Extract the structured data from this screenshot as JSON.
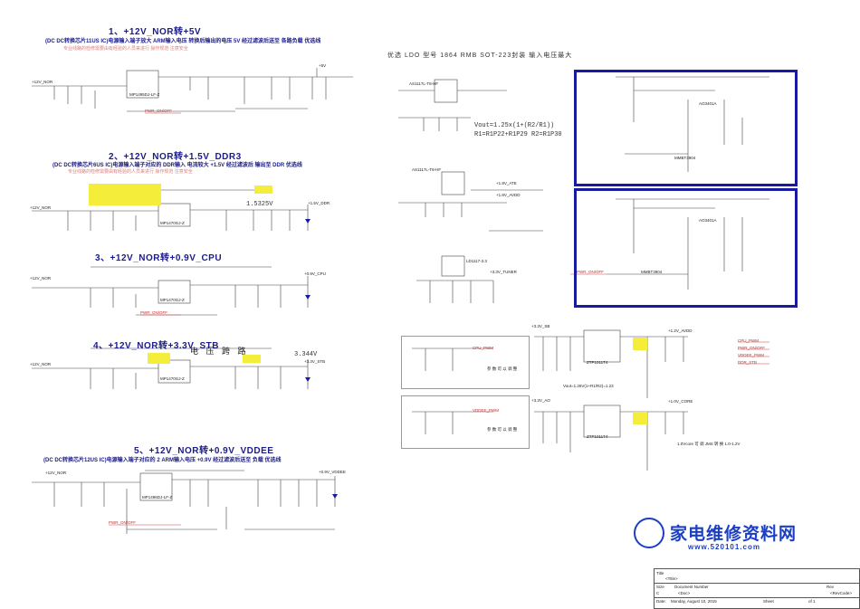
{
  "sections": {
    "s1": {
      "title": "1、+12V_NOR转+5V",
      "note": "(DC DC转换芯片11US IC)电源输入端子放大 ARM输入电压 转换后输出的电压 5V 经过滤波后送至 各路负载 优选线",
      "warn": "专业线路的检修需要由有经验的人员来进行 操作规范 注意安全"
    },
    "s2": {
      "title": "2、+12V_NOR转+1.5V_DDR3",
      "note": "(DC DC转换芯片6US IC)电源输入端子对应的 DDR输入 电流较大 +1.5V 经过滤波后 输出至 DDR 优选线",
      "warn": "专业线路的检修需要由有经验的人员来进行 操作规范 注意安全"
    },
    "s3": {
      "title": "3、+12V_NOR转+0.9V_CPU"
    },
    "s4": {
      "title": "4、+12V_NOR转+3.3V_STB",
      "extra": "电  压  跨  路"
    },
    "s5": {
      "title": "5、+12V_NOR转+0.9V_VDDEE",
      "note": "(DC DC转换芯片12US IC)电源输入端子对应的 2 ARM输入电压 +0.9V 经过滤波后送至 负载 优选线"
    }
  },
  "ldo": {
    "note": "优选 LDO 型号 1864 RMB  SOT-223封装  输入电压最大",
    "formula1": "Vout=1.25x(1+(R2/R1))",
    "formula2": "R1=R1P22+R1P29  R2=R1P30"
  },
  "voltages": {
    "ddr": "1.5325V",
    "stb": "3.344V"
  },
  "chips": [
    "MP1495DJ-LF-Z",
    "MP1470GJ-Z",
    "MP1470GJ-Z",
    "MP1470GJ-Z",
    "MP1496DJ-LF-Z",
    "AS1117L-T8-HF",
    "AS1117L-T8-HF",
    "LD1117-3.3",
    "ZTP1011T4",
    "ZTP1011T4",
    "AO3401A",
    "AO3401A",
    "MMBT3904",
    "MMBT3904"
  ],
  "nets": [
    "+12V_NOR",
    "+5V",
    "+1.5V_DDR",
    "+0.9V_CPU",
    "+3.3V_STB",
    "+0.9V_VDDEE",
    "+3.3V_SB",
    "+3.3V_AO",
    "+1.2V_AVDD",
    "+1.0V_CORE",
    "+1.8V_ATE",
    "+1.8V_AVDD",
    "+3.3V_TUNER",
    "PWR_ON/OFF",
    "CPU_PWM",
    "VDDEE_PWM",
    "DDR_STB",
    "STB_PWM"
  ],
  "dividers": [
    "参 数 可 以 调 整",
    "参 数 可 以 调 整"
  ],
  "notes": {
    "core": "1.0Vcore 可 调 JMS 转 换 1.0-1.2V",
    "avdd": "Vout=1.26V(1+R1/R2)=1.23"
  },
  "title_block": {
    "title": "Title",
    "title_val": "<Title>",
    "size": "Size",
    "size_val": "C",
    "docnum": "Document Number",
    "doc_val": "<Doc>",
    "rev": "Rev",
    "rev_val": "<RevCode>",
    "date": "Date:",
    "date_val": "Monday, August 10, 2015",
    "sheet": "Sheet",
    "sheet_val": "of  1"
  },
  "watermark": {
    "text": "家电维修资料网",
    "url": "www.520101.com"
  }
}
